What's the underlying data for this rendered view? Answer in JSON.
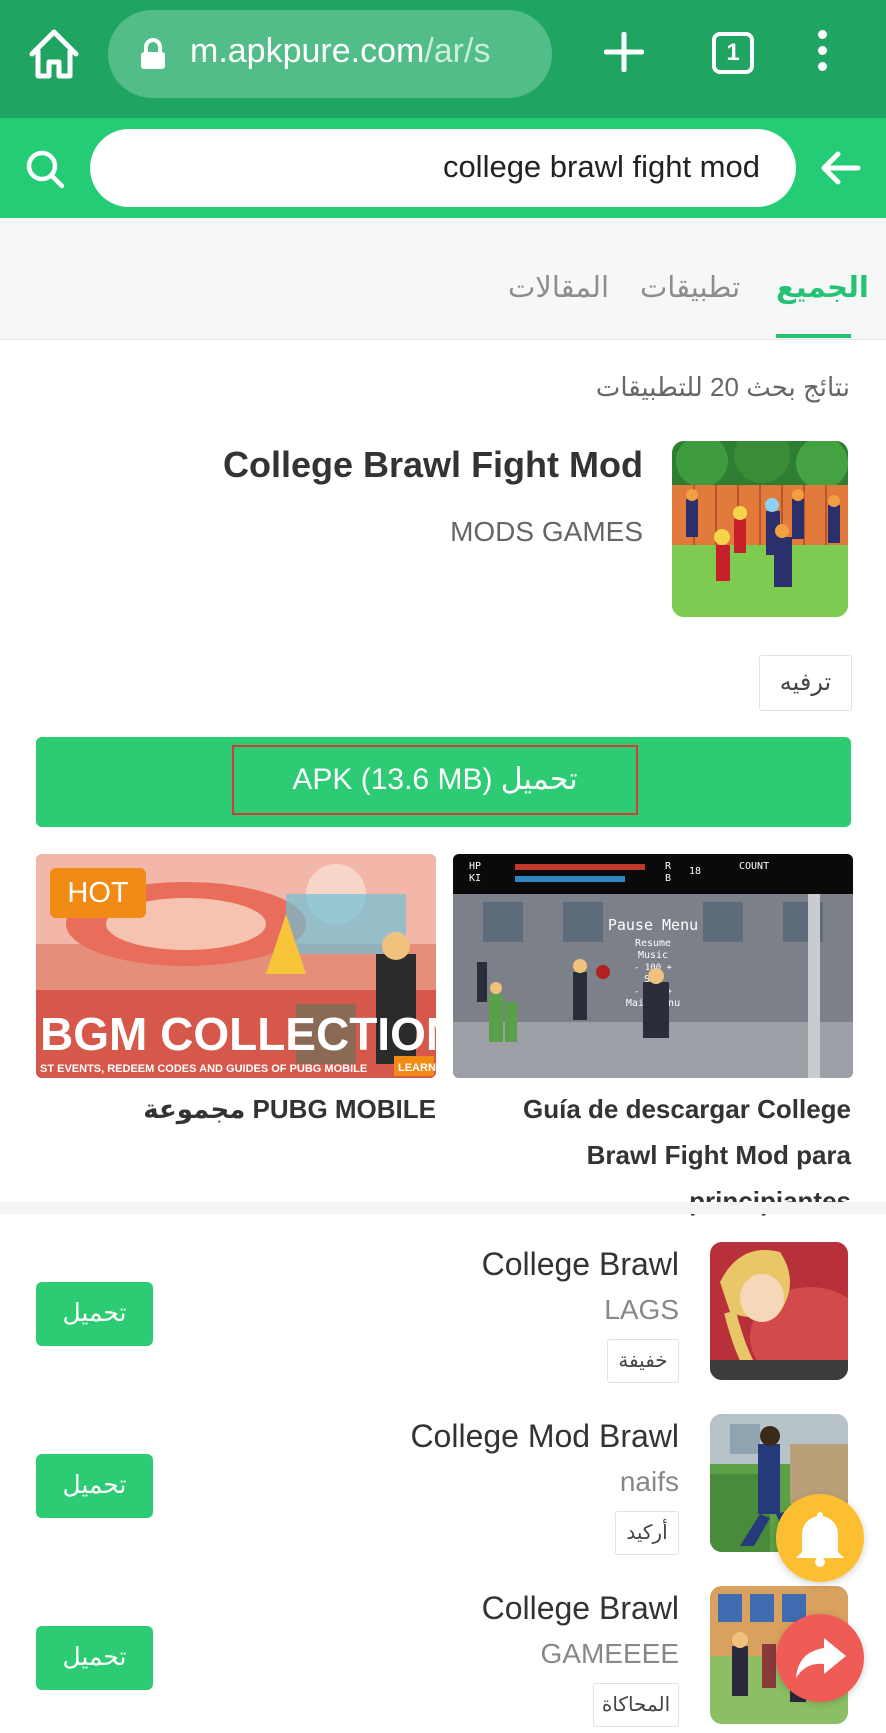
{
  "browser": {
    "url_main": "m.apkpure.com",
    "url_path": "/ar/s",
    "tab_count": "1"
  },
  "search": {
    "query": "college brawl fight mod"
  },
  "tabs": [
    {
      "label": "الجميع"
    },
    {
      "label": "تطبيقات"
    },
    {
      "label": "المقالات"
    }
  ],
  "results_count": "نتائج بحث 20 للتطبيقات",
  "featured": {
    "title": "College Brawl Fight Mod",
    "developer": "MODS GAMES",
    "category": "ترفيه",
    "download_label": "APK (13.6 MB) تحميل"
  },
  "cards": [
    {
      "title": "Guía de descargar College Brawl Fight Mod para principiantes"
    },
    {
      "title": "مجموعة PUBG MOBILE",
      "badge": "HOT",
      "banner_text": "BGM COLLECTION",
      "banner_subtext": "ST EVENTS, REDEEM CODES AND GUIDES OF PUBG MOBILE",
      "banner_learn": "LEARN"
    }
  ],
  "game_screen": {
    "hp": "HP",
    "ki": "KI",
    "r": "R",
    "b": "B",
    "num": "18",
    "count": "COUNT",
    "pause": "Pause Menu",
    "resume": "Resume",
    "music": "Music",
    "vol1": "-    100    +",
    "sfx": "SFX",
    "vol2": "-    100    +",
    "main_menu": "Main Menu"
  },
  "list": [
    {
      "title": "College Brawl",
      "developer": "LAGS",
      "tag": "خفيفة",
      "button": "تحميل"
    },
    {
      "title": "College Mod Brawl",
      "developer": "naifs",
      "tag": "أركيد",
      "button": "تحميل"
    },
    {
      "title": "College Brawl",
      "developer": "GAMEEEE",
      "tag": "المحاكاة",
      "button": "تحميل"
    }
  ],
  "colors": {
    "browser_green": "#1fa462",
    "search_green": "#24cc76",
    "accent": "#2ccb74",
    "hot": "#f28a16",
    "bell": "#fcbf32",
    "share": "#f05c55"
  }
}
